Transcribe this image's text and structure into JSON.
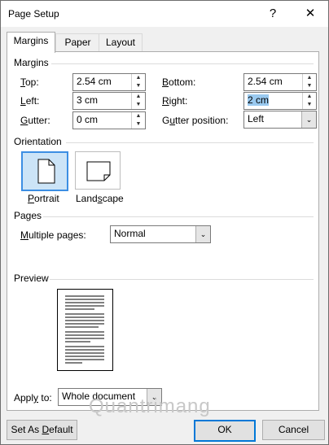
{
  "window": {
    "title": "Page Setup",
    "help_glyph": "?",
    "close_glyph": "✕"
  },
  "tabs": [
    {
      "label": "Margins",
      "active": true
    },
    {
      "label": "Paper",
      "active": false
    },
    {
      "label": "Layout",
      "active": false
    }
  ],
  "margins": {
    "section_label": "Margins",
    "top": {
      "pre": "",
      "key": "T",
      "post": "op:",
      "value": "2.54 cm"
    },
    "left": {
      "pre": "",
      "key": "L",
      "post": "eft:",
      "value": "3 cm"
    },
    "gutter": {
      "pre": "",
      "key": "G",
      "post": "utter:",
      "value": "0 cm"
    },
    "bottom": {
      "pre": "",
      "key": "B",
      "post": "ottom:",
      "value": "2.54 cm"
    },
    "right": {
      "pre": "",
      "key": "R",
      "post": "ight:",
      "value": "2 cm"
    },
    "gutter_position": {
      "pre": "G",
      "key": "u",
      "post": "tter position:",
      "value": "Left"
    }
  },
  "orientation": {
    "section_label": "Orientation",
    "portrait": {
      "pre": "",
      "key": "P",
      "post": "ortrait",
      "selected": true
    },
    "landscape": {
      "pre": "Land",
      "key": "s",
      "post": "cape",
      "selected": false
    }
  },
  "pages": {
    "section_label": "Pages",
    "multiple_pages": {
      "pre": "",
      "key": "M",
      "post": "ultiple pages:",
      "value": "Normal"
    }
  },
  "preview": {
    "section_label": "Preview"
  },
  "apply_to": {
    "pre": "Appl",
    "key": "y",
    "post": " to:",
    "value": "Whole document"
  },
  "buttons": {
    "set_default": {
      "pre": "Set As ",
      "key": "D",
      "post": "efault"
    },
    "ok": "OK",
    "cancel": "Cancel"
  },
  "watermark": "Quantrimang",
  "colors": {
    "selection_highlight": "#99c9ef",
    "focus_border": "#0078d7",
    "selected_orientation_bg": "#cce4f7"
  }
}
